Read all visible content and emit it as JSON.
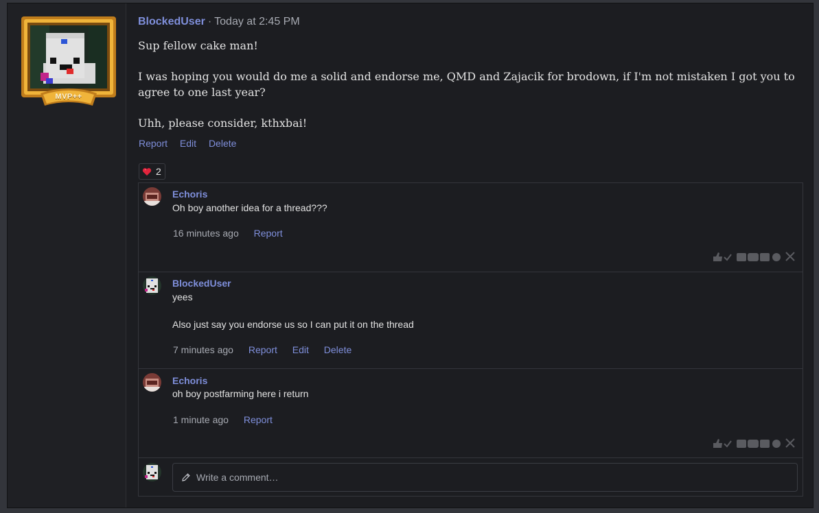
{
  "post": {
    "author": "BlockedUser",
    "separator": "·",
    "time": "Today at 2:45 PM",
    "avatar_badge": "MVP++",
    "paragraphs": [
      "Sup fellow cake man!",
      "I was hoping you would do me a solid and endorse me, QMD and Zajacik for brodown, if I'm not mistaken I got you to agree to one last year?",
      "Uhh, please consider, kthxbai!"
    ],
    "actions": {
      "report": "Report",
      "edit": "Edit",
      "delete": "Delete"
    },
    "reaction": {
      "icon": "heart-icon",
      "count": "2"
    }
  },
  "comments": [
    {
      "author": "Echoris",
      "lines": [
        "Oh boy another idea for a thread???"
      ],
      "time": "16 minutes ago",
      "actions": {
        "report": "Report"
      }
    },
    {
      "author": "BlockedUser",
      "lines": [
        "yees",
        "Also just say you endorse us so I can put it on the thread"
      ],
      "time": "7 minutes ago",
      "actions": {
        "report": "Report",
        "edit": "Edit",
        "delete": "Delete"
      }
    },
    {
      "author": "Echoris",
      "lines": [
        "oh boy postfarming here i return"
      ],
      "time": "1 minute ago",
      "actions": {
        "report": "Report"
      }
    }
  ],
  "composer": {
    "placeholder": "Write a comment…",
    "icon": "pencil-icon"
  },
  "colors": {
    "link": "#7f8fdb",
    "background": "#1c1d21",
    "frame_gold": "#d4962a"
  }
}
